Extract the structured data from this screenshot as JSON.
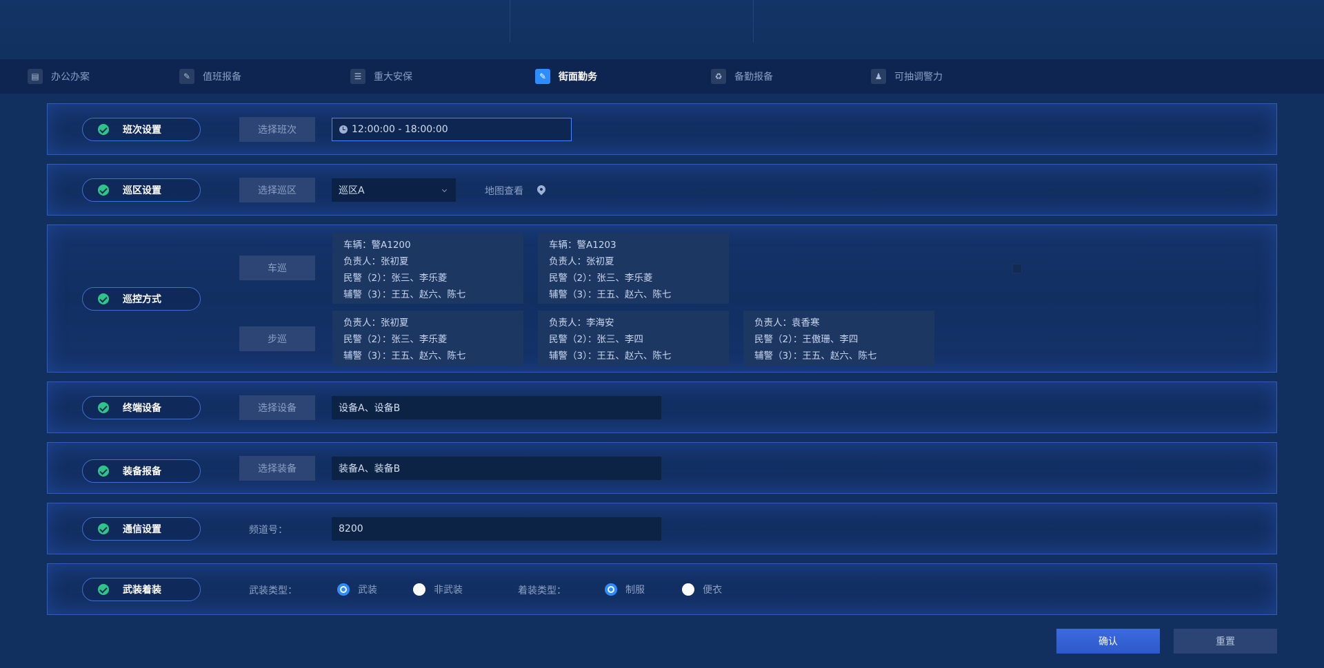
{
  "nav": {
    "items": [
      {
        "label": "办公办案",
        "icon": "document-icon"
      },
      {
        "label": "值班报备",
        "icon": "edit-document-icon"
      },
      {
        "label": "重大安保",
        "icon": "checklist-icon"
      },
      {
        "label": "街面勤务",
        "icon": "edit-document-icon",
        "active": true
      },
      {
        "label": "备勤报备",
        "icon": "recycle-icon"
      },
      {
        "label": "可抽调警力",
        "icon": "person-document-icon"
      }
    ]
  },
  "shift": {
    "title": "班次设置",
    "button": "选择班次",
    "time_range": "12:00:00 - 18:00:00"
  },
  "patrol_area": {
    "title": "巡区设置",
    "button": "选择巡区",
    "selected": "巡区A",
    "map_label": "地图查看"
  },
  "patrol_mode": {
    "title": "巡控方式",
    "vehicle_button": "车巡",
    "foot_button": "步巡",
    "vehicle_cards": [
      {
        "vehicle": "车辆：警A1200",
        "leader": "负责人：张初夏",
        "police": "民警（2）：张三、李乐菱",
        "auxiliary": "辅警（3）：王五、赵六、陈七"
      },
      {
        "vehicle": "车辆：警A1203",
        "leader": "负责人：张初夏",
        "police": "民警（2）：张三、李乐菱",
        "auxiliary": "辅警（3）：王五、赵六、陈七"
      }
    ],
    "foot_cards": [
      {
        "leader": "负责人：张初夏",
        "police": "民警（2）：张三、李乐菱",
        "auxiliary": "辅警（3）：王五、赵六、陈七"
      },
      {
        "leader": "负责人：李海安",
        "police": "民警（2）：张三、李四",
        "auxiliary": "辅警（3）：王五、赵六、陈七"
      },
      {
        "leader": "负责人：袁香寒",
        "police": "民警（2）：王傲珊、李四",
        "auxiliary": "辅警（3）：王五、赵六、陈七"
      }
    ]
  },
  "terminal": {
    "title": "终端设备",
    "button": "选择设备",
    "value": "设备A、设备B"
  },
  "equipment": {
    "title": "装备报备",
    "button": "选择装备",
    "value": "装备A、装备B"
  },
  "comms": {
    "title": "通信设置",
    "channel_label": "频道号：",
    "channel_value": "8200"
  },
  "armed": {
    "title": "武装着装",
    "armed_type_label": "武装类型：",
    "armed_options": [
      "武装",
      "非武装"
    ],
    "armed_selected": "武装",
    "dress_type_label": "着装类型：",
    "dress_options": [
      "制服",
      "便衣"
    ],
    "dress_selected": "制服"
  },
  "actions": {
    "confirm": "确认",
    "reset": "重置"
  },
  "colors": {
    "background": "#11305f",
    "panel_border": "#2f5db8",
    "accent": "#2d8cff",
    "check": "#2fc48a"
  }
}
